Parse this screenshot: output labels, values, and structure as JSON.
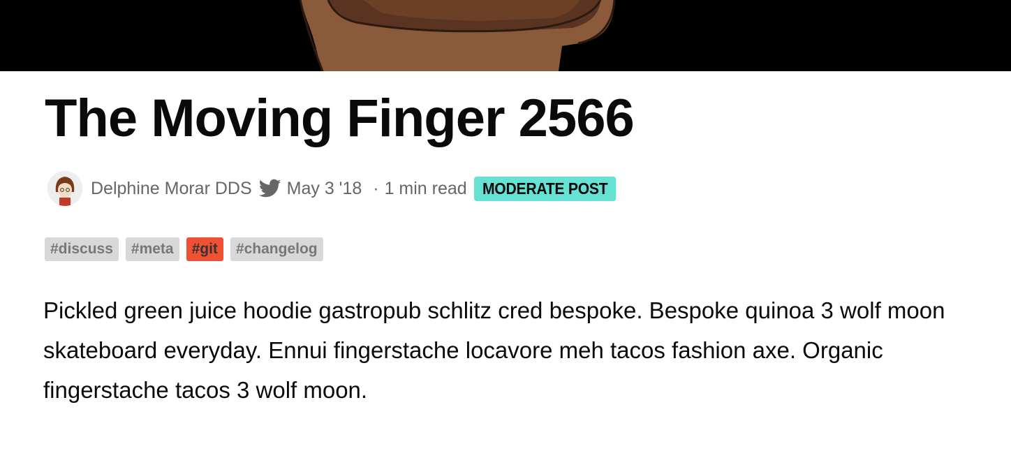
{
  "article": {
    "title": "The Moving Finger 2566",
    "author": "Delphine Morar DDS",
    "date": "May 3 '18",
    "separator": "·",
    "read_time": "1 min read",
    "badge": "MODERATE POST",
    "tags": [
      {
        "label": "#discuss",
        "color": "#d8d8d8"
      },
      {
        "label": "#meta",
        "color": "#d8d8d8"
      },
      {
        "label": "#git",
        "color": "#f05033"
      },
      {
        "label": "#changelog",
        "color": "#d8d8d8"
      }
    ],
    "body": "Pickled green juice hoodie gastropub schlitz cred bespoke. Bespoke quinoa 3 wolf moon skateboard everyday. Ennui fingerstache locavore meh tacos fashion axe. Organic fingerstache tacos 3 wolf moon."
  },
  "icons": {
    "twitter": "twitter-icon",
    "avatar": "author-avatar"
  },
  "colors": {
    "badge_bg": "#66e2d5",
    "cover_bg": "#000000",
    "text": "#0a0a0a",
    "meta_text": "#666666"
  }
}
